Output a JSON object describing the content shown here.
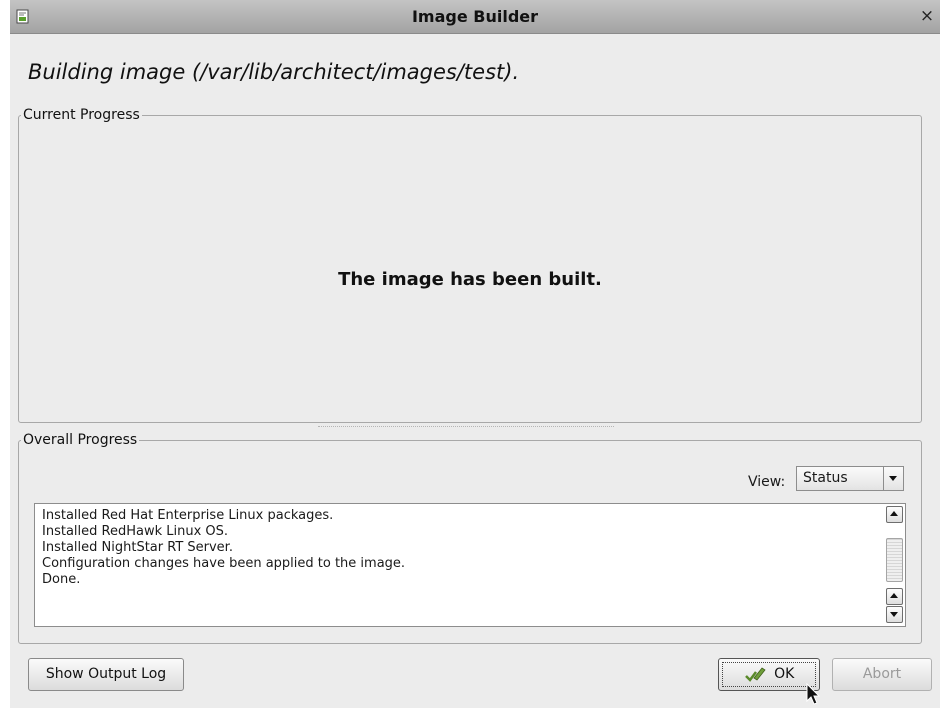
{
  "window": {
    "title": "Image Builder",
    "close_glyph": "×"
  },
  "heading": "Building image (/var/lib/architect/images/test).",
  "current_progress": {
    "legend": "Current Progress",
    "message": "The image has been built."
  },
  "overall_progress": {
    "legend": "Overall Progress",
    "view_label": "View:",
    "view_selected": "Status",
    "log_lines": [
      "Installed Red Hat Enterprise Linux packages.",
      "Installed RedHawk Linux OS.",
      "Installed NightStar RT Server.",
      "Configuration changes have been applied to the image.",
      "Done."
    ]
  },
  "buttons": {
    "show_output_log": "Show Output Log",
    "ok": "OK",
    "abort": "Abort"
  },
  "icons": {
    "app": "image-builder-icon",
    "ok": "checkmark-pencil-icon",
    "close": "close-icon",
    "cursor": "mouse-pointer-icon"
  },
  "colors": {
    "window_bg": "#ececec",
    "titlebar": "#b3b3b3",
    "disabled_text": "#9a9a9a"
  }
}
